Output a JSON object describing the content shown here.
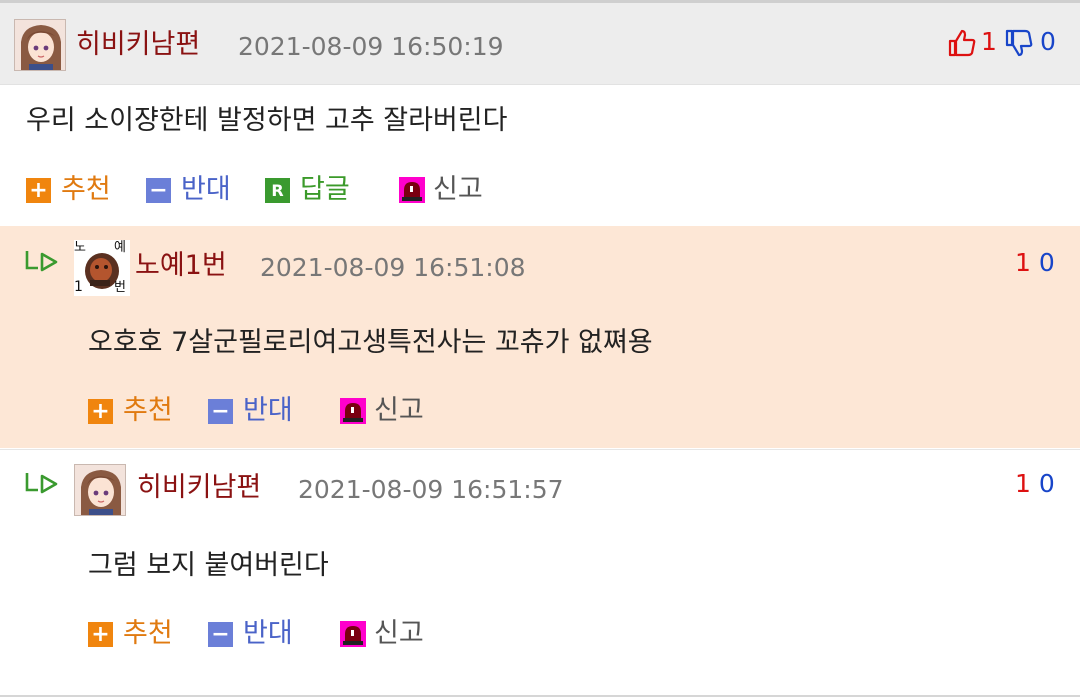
{
  "main_comment": {
    "nickname": "히비키남편",
    "date": "2021-08-09 16:50:19",
    "upvotes": "1",
    "downvotes": "0",
    "text": "우리 소이쟝한테 발정하면 고추 잘라버린다",
    "actions": {
      "recommend": "추천",
      "oppose": "반대",
      "reply": "답글",
      "report": "신고"
    }
  },
  "replies": [
    {
      "nickname": "노예1번",
      "avatar_text": [
        "노",
        "예",
        "1",
        "번"
      ],
      "date": "2021-08-09 16:51:08",
      "upvotes": "1",
      "downvotes": "0",
      "text": "오호호 7살군필로리여고생특전사는 꼬츄가 없쪄용",
      "actions": {
        "recommend": "추천",
        "oppose": "반대",
        "report": "신고"
      }
    },
    {
      "nickname": "히비키남편",
      "date": "2021-08-09 16:51:57",
      "upvotes": "1",
      "downvotes": "0",
      "text": "그럼 보지 붙여버린다",
      "actions": {
        "recommend": "추천",
        "oppose": "반대",
        "report": "신고"
      }
    }
  ],
  "colors": {
    "nickname": "#8a1212",
    "recommend": "#f0850e",
    "oppose": "#6b7fd8",
    "reply": "#3a9a2f",
    "report_icon": "#ff00cc",
    "reply_highlight_bg": "#fde7d6",
    "header_bg": "#ededed"
  },
  "icons": {
    "upvote": "thumbs-up-icon",
    "downvote": "thumbs-down-icon",
    "recommend": "plus-icon",
    "oppose": "minus-icon",
    "reply": "reply-r-icon",
    "report": "siren-icon",
    "reply_indicator": "reply-arrow-icon"
  }
}
